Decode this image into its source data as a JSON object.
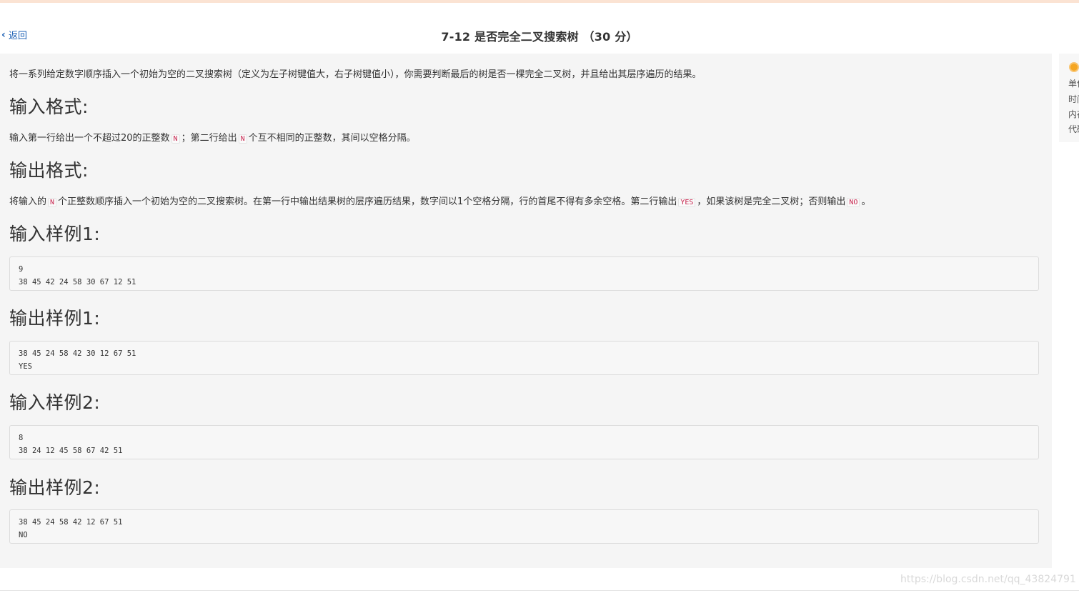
{
  "header": {
    "back_label": "返回",
    "title": "7-12 是否完全二叉搜索树 （30 分）"
  },
  "problem": {
    "description": "将一系列给定数字顺序插入一个初始为空的二叉搜索树（定义为左子树键值大，右子树键值小），你需要判断最后的树是否一棵完全二叉树，并且给出其层序遍历的结果。",
    "input_heading": "输入格式:",
    "input_desc": {
      "part1": "输入第一行给出一个不超过20的正整数",
      "code1": "N",
      "part2": "；第二行给出",
      "code2": "N",
      "part3": "个互不相同的正整数，其间以空格分隔。"
    },
    "output_heading": "输出格式:",
    "output_desc": {
      "part1": "将输入的",
      "code1": "N",
      "part2": "个正整数顺序插入一个初始为空的二叉搜索树。在第一行中输出结果树的层序遍历结果，数字间以1个空格分隔，行的首尾不得有多余空格。第二行输出",
      "code2": "YES",
      "part3": "，如果该树是完全二叉树；否则输出",
      "code3": "NO",
      "part4": "。"
    },
    "samples": [
      {
        "heading": "输入样例1:",
        "content": "9\n38 45 42 24 58 30 67 12 51"
      },
      {
        "heading": "输出样例1:",
        "content": "38 45 24 58 42 30 12 67 51\nYES"
      },
      {
        "heading": "输入样例2:",
        "content": "8\n38 24 12 45 58 67 42 51"
      },
      {
        "heading": "输出样例2:",
        "content": "38 45 24 58 42 12 67 51\nNO"
      }
    ]
  },
  "side_panel": {
    "lines": [
      "单位",
      "时间",
      "内存",
      "代码"
    ]
  },
  "watermark": "https://blog.csdn.net/qq_43824791"
}
